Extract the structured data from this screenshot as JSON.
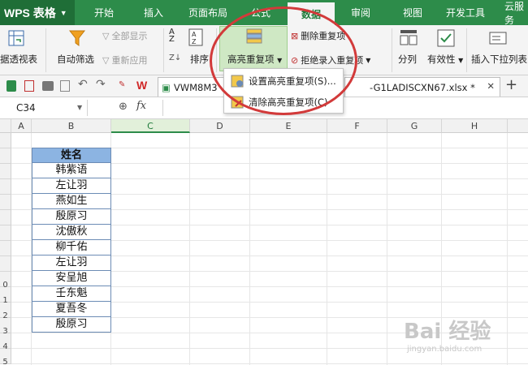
{
  "app": {
    "title": "WPS 表格"
  },
  "tabs": [
    "开始",
    "插入",
    "页面布局",
    "公式",
    "数据",
    "审阅",
    "视图",
    "开发工具",
    "云服务"
  ],
  "active_tab": "数据",
  "ribbon": {
    "pivot": "据透视表",
    "autofilter": "自动筛选",
    "show_all": "全部显示",
    "reapply": "重新应用",
    "sort": "排序",
    "highlight_dup": "高亮重复项",
    "delete_dup": "删除重复项",
    "reject_dup": "拒绝录入重复项",
    "split_col": "分列",
    "validity": "有效性",
    "insert_dropdown": "插入下拉列表"
  },
  "dropdown_menu": {
    "set_highlight": "设置高亮重复项(S)...",
    "clear_highlight": "清除高亮重复项(C)"
  },
  "docs": {
    "doc1": "VWM8M3",
    "doc2": "-G1LADISCXN67.xlsx *"
  },
  "formula": {
    "cell_ref": "C34",
    "fx": "fx"
  },
  "columns": [
    "A",
    "B",
    "C",
    "D",
    "E",
    "F",
    "G",
    "H"
  ],
  "rows": [
    "",
    "",
    "",
    "",
    "",
    "",
    "",
    "",
    "",
    "0",
    "1",
    "2",
    "3",
    "4",
    "5"
  ],
  "sheet": {
    "header": "姓名",
    "names": [
      "韩紫语",
      "左让羽",
      "燕如生",
      "殷原习",
      "沈傲秋",
      "柳千佑",
      "左让羽",
      "安呈旭",
      "壬东魁",
      "夏吾冬",
      "殷原习"
    ]
  },
  "watermark": {
    "brand": "Bai 经验",
    "url": "jingyan.baidu.com"
  },
  "colors": {
    "brand_green": "#2d8c4a",
    "header_fill": "#8cb4e2",
    "annotation_red": "#d23a3a"
  }
}
